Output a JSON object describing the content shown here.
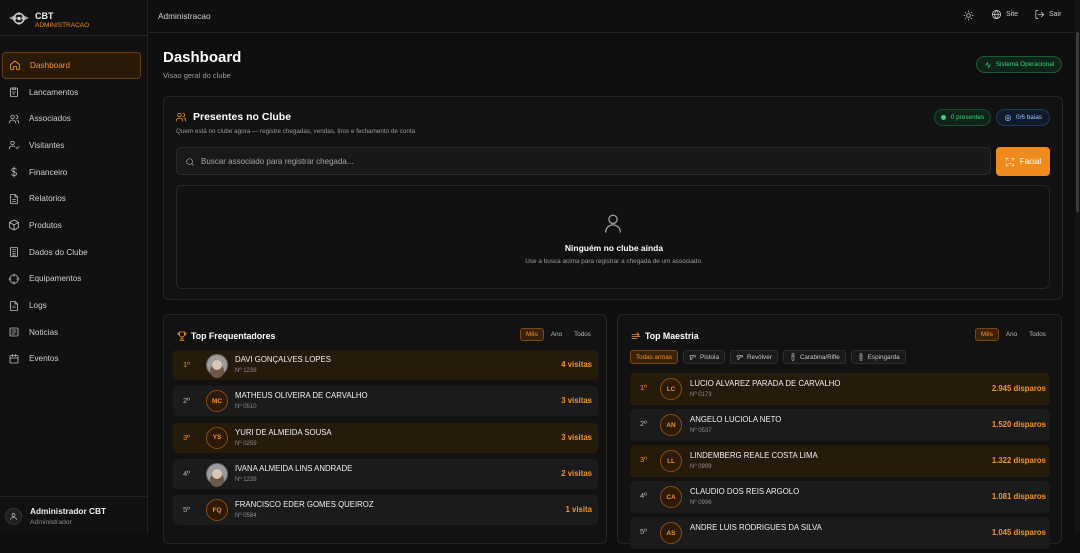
{
  "brand": {
    "title": "CBT",
    "subtitle": "ADMINISTRACAO"
  },
  "nav": [
    {
      "label": "Dashboard",
      "icon": "home-icon",
      "active": true
    },
    {
      "label": "Lancamentos",
      "icon": "clipboard-icon"
    },
    {
      "label": "Associados",
      "icon": "users-icon"
    },
    {
      "label": "Visitantes",
      "icon": "user-check-icon"
    },
    {
      "label": "Financeiro",
      "icon": "dollar-icon"
    },
    {
      "label": "Relatorios",
      "icon": "file-text-icon"
    },
    {
      "label": "Produtos",
      "icon": "package-icon"
    },
    {
      "label": "Dados do Clube",
      "icon": "building-icon"
    },
    {
      "label": "Equipamentos",
      "icon": "crosshair-icon"
    },
    {
      "label": "Logs",
      "icon": "file-icon"
    },
    {
      "label": "Noticias",
      "icon": "newspaper-icon"
    },
    {
      "label": "Eventos",
      "icon": "calendar-icon"
    }
  ],
  "user": {
    "name": "Administrador CBT",
    "role": "Administrador"
  },
  "topbar": {
    "breadcrumb": "Administracao",
    "site": "Site",
    "logout": "Sair"
  },
  "header": {
    "title": "Dashboard",
    "subtitle": "Visao geral do clube",
    "status": "Sistema Operacional"
  },
  "presence": {
    "title": "Presentes no Clube",
    "description": "Quem está no clube agora — registre chegadas, vendas, tiros e fechamento de conta",
    "present_badge": "0 presentes",
    "bays_badge": "0/6 baias",
    "search_placeholder": "Buscar associado para registrar chegada...",
    "facial_button": "Facial",
    "empty_title": "Ninguém no clube ainda",
    "empty_desc": "Use a busca acima para registrar a chegada de um associado."
  },
  "frequent": {
    "title": "Top Frequentadores",
    "periods": [
      "Mês",
      "Ano",
      "Todos"
    ],
    "active_period": 0,
    "rows": [
      {
        "pos": "1º",
        "name": "DAVI GONÇALVES LOPES",
        "number": "Nº 1238",
        "value": "4 visitas",
        "initials": "",
        "photo": true,
        "highlight": true
      },
      {
        "pos": "2º",
        "name": "MATHEUS OLIVEIRA DE CARVALHO",
        "number": "Nº 0510",
        "value": "3 visitas",
        "initials": "MC",
        "photo": false,
        "highlight": false
      },
      {
        "pos": "3º",
        "name": "YURI DE ALMEIDA SOUSA",
        "number": "Nº 0259",
        "value": "3 visitas",
        "initials": "YS",
        "photo": false,
        "highlight": true
      },
      {
        "pos": "4º",
        "name": "IVANA ALMEIDA LINS ANDRADE",
        "number": "Nº 1239",
        "value": "2 visitas",
        "initials": "",
        "photo": true,
        "highlight": false
      },
      {
        "pos": "5º",
        "name": "FRANCISCO EDER GOMES QUEIROZ",
        "number": "Nº 0584",
        "value": "1 visita",
        "initials": "FQ",
        "photo": false,
        "highlight": false
      }
    ]
  },
  "mastery": {
    "title": "Top Maestria",
    "periods": [
      "Mês",
      "Ano",
      "Todos"
    ],
    "active_period": 0,
    "weapons": [
      "Todas armas",
      "Pistola",
      "Revólver",
      "Carabina/Rifle",
      "Espingarda"
    ],
    "active_weapon": 0,
    "rows": [
      {
        "pos": "1º",
        "name": "LUCIO ALVAREZ PARADA DE CARVALHO",
        "number": "Nº 0173",
        "value": "2.945 disparos",
        "initials": "LC",
        "highlight": true
      },
      {
        "pos": "2º",
        "name": "ANGELO LUCIOLA NETO",
        "number": "Nº 0537",
        "value": "1.520 disparos",
        "initials": "AN",
        "highlight": false
      },
      {
        "pos": "3º",
        "name": "LINDEMBERG REALE COSTA LIMA",
        "number": "Nº 0999",
        "value": "1.322 disparos",
        "initials": "LL",
        "highlight": true
      },
      {
        "pos": "4º",
        "name": "CLAUDIO DOS REIS ARGOLO",
        "number": "Nº 0996",
        "value": "1.081 disparos",
        "initials": "CA",
        "highlight": false
      },
      {
        "pos": "5º",
        "name": "ANDRE LUIS RODRIGUES DA SILVA",
        "number": "",
        "value": "1.045 disparos",
        "initials": "AS",
        "highlight": false
      }
    ]
  },
  "colors": {
    "accent": "#f39523",
    "success": "#3ed07a",
    "info": "#9cc4ff",
    "background": "#0e0e0e"
  }
}
